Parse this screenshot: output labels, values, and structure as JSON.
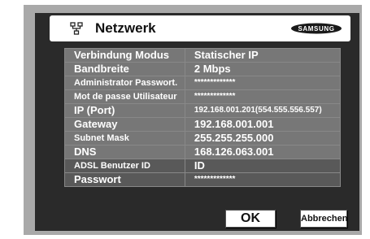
{
  "window": {
    "title": "Netzwerk",
    "icon": "network-icon",
    "logo_text": "SAMSUNG"
  },
  "settings": [
    {
      "label": "Verbindung Modus",
      "value": "Statischer IP",
      "label_size": 13,
      "value_size": 13,
      "shade": "std"
    },
    {
      "label": "Bandbreite",
      "value": "2 Mbps",
      "label_size": 13,
      "value_size": 13,
      "shade": "std"
    },
    {
      "label": "Administrator Passwort.",
      "value": "*************",
      "label_size": 11,
      "value_size": 10,
      "shade": "std"
    },
    {
      "label": "Mot de passe Utilisateur",
      "value": "*************",
      "label_size": 11,
      "value_size": 10,
      "shade": "std"
    },
    {
      "label": "IP (Port)",
      "value": "192.168.001.201(554.555.556.557)",
      "label_size": 13,
      "value_size": 10,
      "shade": "std"
    },
    {
      "label": "Gateway",
      "value": "192.168.001.001",
      "label_size": 13,
      "value_size": 13,
      "shade": "std"
    },
    {
      "label": "Subnet Mask",
      "value": "255.255.255.000",
      "label_size": 11,
      "value_size": 13,
      "shade": "std"
    },
    {
      "label": "DNS",
      "value": "168.126.063.001",
      "label_size": 13,
      "value_size": 13,
      "shade": "std"
    },
    {
      "label": "ADSL Benutzer ID",
      "value": "ID",
      "label_size": 11,
      "value_size": 13,
      "shade": "dark"
    },
    {
      "label": "Passwort",
      "value": "*************",
      "label_size": 13,
      "value_size": 10,
      "shade": "dark"
    }
  ],
  "buttons": {
    "ok": "OK",
    "cancel": "Abbrechen"
  }
}
